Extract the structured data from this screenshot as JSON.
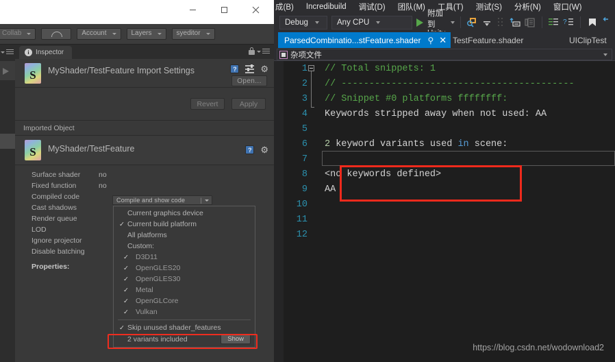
{
  "unity": {
    "window_controls": [
      {
        "name": "minimize",
        "glyph": "minimize-icon"
      },
      {
        "name": "maximize",
        "glyph": "maximize-icon"
      },
      {
        "name": "close",
        "glyph": "close-icon"
      }
    ],
    "toolbar": {
      "collab_label": "Collab",
      "cloud_label": "cloud-icon",
      "account_label": "Account",
      "layers_label": "Layers",
      "layout_label": "syeditor"
    },
    "inspector": {
      "tab_label": "Inspector",
      "lock_icon": "lock-icon",
      "menu_icon": "hamburger-menu-icon",
      "import_title": "MyShader/TestFeature Import Settings",
      "thumb_letter": "S",
      "help_icon": "?",
      "open_label": "Open...",
      "revert_label": "Revert",
      "apply_label": "Apply",
      "imported_object_label": "Imported Object",
      "object_title": "MyShader/TestFeature",
      "properties": [
        {
          "label": "Surface shader",
          "value": "no"
        },
        {
          "label": "Fixed function",
          "value": "no"
        },
        {
          "label": "Compiled code",
          "value": ""
        },
        {
          "label": "Cast shadows",
          "value": ""
        },
        {
          "label": "Render queue",
          "value": ""
        },
        {
          "label": "LOD",
          "value": ""
        },
        {
          "label": "Ignore projector",
          "value": ""
        },
        {
          "label": "Disable batching",
          "value": ""
        }
      ],
      "properties_heading": "Properties:",
      "compiled_code_field": {
        "value": "Compile and show code",
        "divider": "|"
      },
      "platform_menu": [
        {
          "label": "Current graphics device",
          "checked": false,
          "sub": false
        },
        {
          "label": "Current build platform",
          "checked": true,
          "sub": false
        },
        {
          "label": "All platforms",
          "checked": false,
          "sub": false
        },
        {
          "label": "Custom:",
          "checked": false,
          "sub": false
        },
        {
          "label": "D3D11",
          "checked": true,
          "sub": true
        },
        {
          "label": "OpenGLES20",
          "checked": true,
          "sub": true
        },
        {
          "label": "OpenGLES30",
          "checked": true,
          "sub": true
        },
        {
          "label": "Metal",
          "checked": true,
          "sub": true
        },
        {
          "label": "OpenGLCore",
          "checked": true,
          "sub": true
        },
        {
          "label": "Vulkan",
          "checked": true,
          "sub": true
        }
      ],
      "skip_unused_label": "Skip unused shader_features",
      "skip_unused_checked": true,
      "variants_label": "2 variants included",
      "show_label": "Show"
    }
  },
  "vs": {
    "menus": [
      "成(B)",
      "Incredibuild",
      "调试(D)",
      "团队(M)",
      "工具(T)",
      "测试(S)",
      "分析(N)",
      "窗口(W)"
    ],
    "toolbar": {
      "config": "Debug",
      "platform": "Any CPU",
      "attach_label": "附加到 Unity",
      "icons": [
        "find-in-files-icon",
        "toggle-bookmark-down-icon",
        "comment-selection-icon",
        "uncomment-selection-icon",
        "increase-indent-icon",
        "decrease-indent-icon",
        "bookmark-icon",
        "undo-icon"
      ]
    },
    "tabs": [
      {
        "label": "ParsedCombinatio...stFeature.shader",
        "active": true,
        "pin": "pin-icon",
        "close": "close-icon"
      },
      {
        "label": "TestFeature.shader",
        "active": false
      },
      {
        "label": "UIClipTest",
        "active": false
      }
    ],
    "navbar": {
      "icon": "misc-files-icon",
      "text": "杂项文件"
    },
    "code": {
      "lines": [
        {
          "n": "1",
          "segments": [
            {
              "t": "// Total snippets: 1",
              "c": "cmt"
            }
          ]
        },
        {
          "n": "2",
          "segments": [
            {
              "t": "// ------------------------------------------",
              "c": "cmt"
            }
          ]
        },
        {
          "n": "3",
          "segments": [
            {
              "t": "// Snippet #0 platforms ffffffff:",
              "c": "cmt"
            }
          ]
        },
        {
          "n": "4",
          "segments": [
            {
              "t": "Keywords stripped away when not used: AA",
              "c": "txt"
            }
          ]
        },
        {
          "n": "5",
          "segments": [
            {
              "t": "",
              "c": "txt"
            }
          ]
        },
        {
          "n": "6",
          "segments": [
            {
              "t": "2",
              "c": "num"
            },
            {
              "t": " keyword variants used ",
              "c": "txt"
            },
            {
              "t": "in",
              "c": "kw"
            },
            {
              "t": " scene:",
              "c": "txt"
            }
          ]
        },
        {
          "n": "7",
          "segments": [
            {
              "t": "",
              "c": "txt"
            }
          ]
        },
        {
          "n": "8",
          "segments": [
            {
              "t": "<no keywords defined>",
              "c": "txt"
            }
          ]
        },
        {
          "n": "9",
          "segments": [
            {
              "t": "AA",
              "c": "txt"
            }
          ]
        },
        {
          "n": "10",
          "segments": [
            {
              "t": "",
              "c": "txt"
            }
          ]
        },
        {
          "n": "11",
          "segments": [
            {
              "t": "",
              "c": "txt"
            }
          ]
        },
        {
          "n": "12",
          "segments": [
            {
              "t": "",
              "c": "txt"
            }
          ]
        }
      ]
    },
    "watermark": "https://blog.csdn.net/wodownload2"
  },
  "colors": {
    "accent_blue": "#007acc",
    "highlight_red": "#ee2a1c",
    "comment_green": "#57a64a",
    "linenum_blue": "#2b91af",
    "keyword_blue": "#569cd6",
    "number_green": "#b5cea8"
  }
}
